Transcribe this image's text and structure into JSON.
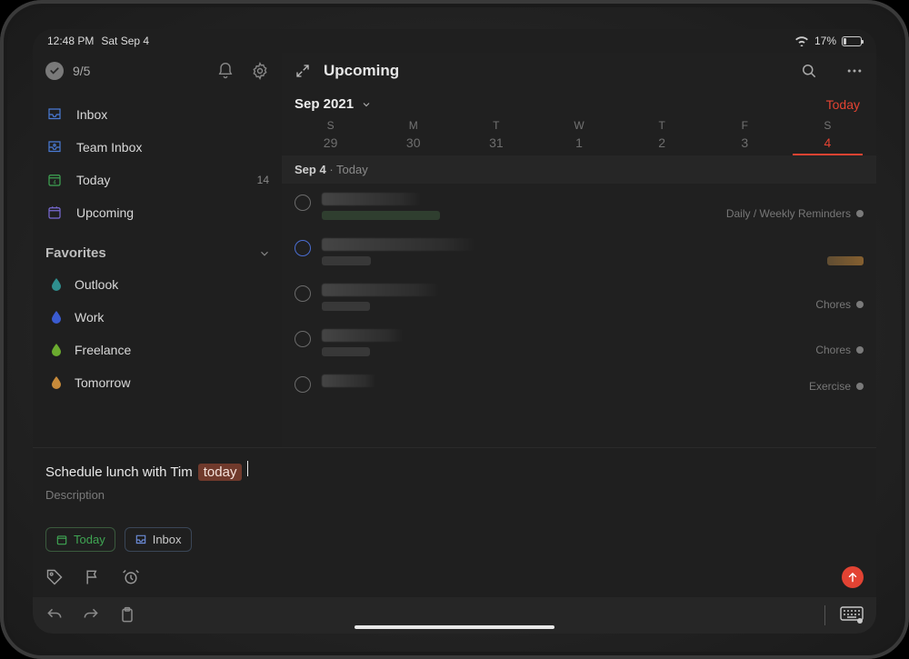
{
  "status": {
    "time": "12:48 PM",
    "date": "Sat Sep 4",
    "battery_pct": "17%"
  },
  "sidebar": {
    "progress_label": "9/5",
    "nav": {
      "inbox": "Inbox",
      "team_inbox": "Team Inbox",
      "today": "Today",
      "today_count": "14",
      "upcoming": "Upcoming"
    },
    "favorites_header": "Favorites",
    "favorites": {
      "outlook": "Outlook",
      "work": "Work",
      "freelance": "Freelance",
      "tomorrow": "Tomorrow"
    }
  },
  "main": {
    "title": "Upcoming",
    "month_label": "Sep 2021",
    "today_link": "Today",
    "dows": {
      "d0": "S",
      "d1": "M",
      "d2": "T",
      "d3": "W",
      "d4": "T",
      "d5": "F",
      "d6": "S"
    },
    "days": {
      "n0": "29",
      "n1": "30",
      "n2": "31",
      "n3": "1",
      "n4": "2",
      "n5": "3",
      "n6": "4"
    },
    "day_header_date": "Sep 4",
    "day_header_label": "Today",
    "tasks": {
      "t0_meta": "Daily / Weekly Reminders",
      "t2_meta": "Chores",
      "t3_meta": "Chores",
      "t4_meta": "Exercise"
    }
  },
  "quickadd": {
    "text": "Schedule lunch with Tim",
    "chip_text": "today",
    "description_placeholder": "Description",
    "date_chip": "Today",
    "project_chip": "Inbox"
  }
}
